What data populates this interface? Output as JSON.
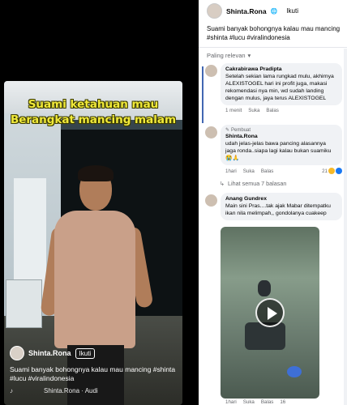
{
  "video": {
    "overlay_title_line1": "Suami ketahuan mau",
    "overlay_title_line2": "Berangkat mancing malam",
    "author": "Shinta.Rona",
    "follow": "Ikuti",
    "description": "Suami banyak bohongnya kalau mau mancing #shinta #lucu #viralindonesia",
    "audio": "Shinta.Rona · Audi"
  },
  "post": {
    "author": "Shinta.Rona",
    "visibility_icon": "globe-icon",
    "follow": "Ikuti",
    "text": "Suami banyak bohongnya kalau mau mancing #shinta #lucu #viralindonesia",
    "sort_label": "Paling relevan"
  },
  "comments": [
    {
      "name": "Cakrabirawa Pradipta",
      "text": "Setelah sekian lama rungkad mulu, akhirnya ALEXISTOGEL hari ini profit juga, makasi rekomendasi nya min, wd sudah landing dengan mulus, jaya terus ALEXISTOGEL",
      "time": "1 menit",
      "like": "Suka",
      "reply": "Balas"
    },
    {
      "badge": "Pembuat",
      "name": "Shinta.Rona",
      "text": "udah jelas-jelas bawa pancing alasannya jaga ronda..siapa lagi kalau bukan suamiku 😭🙏",
      "time": "1hari",
      "like": "Suka",
      "reply": "Balas",
      "reactions": "21"
    },
    {
      "name": "Anang Gundrex",
      "text": "Main sini Pras....tak ajak Mabar ditempatku ikan nila melimpah,, gondolanya cuakeep",
      "time": "1hari",
      "like": "Suka",
      "reply": "Balas",
      "reactions": "16"
    }
  ],
  "view_replies": "Lihat semua 7 balasan",
  "colors": {
    "link": "#4267b2",
    "overlay_text": "#f0e93a",
    "react_like": "#1877f2",
    "react_haha": "#f7b928"
  }
}
